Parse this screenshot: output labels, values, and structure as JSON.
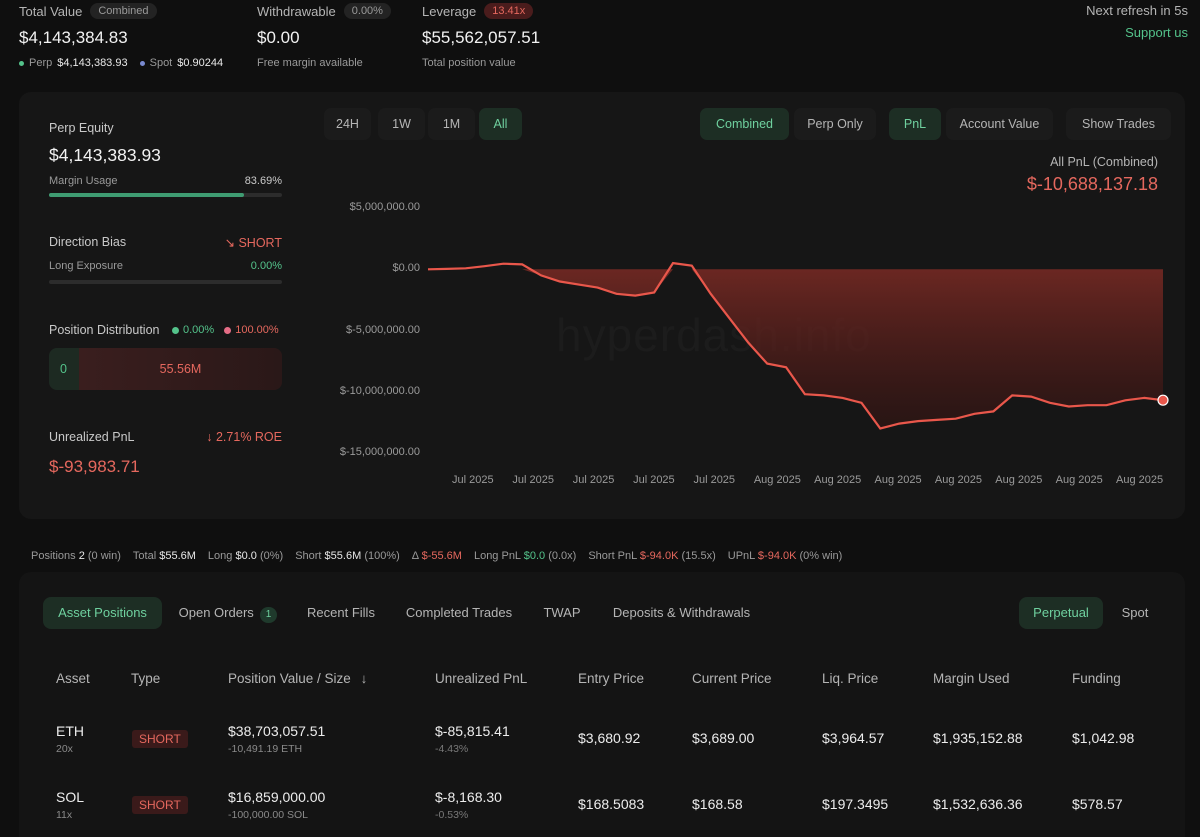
{
  "top": {
    "total_value": {
      "label": "Total Value",
      "pill": "Combined",
      "value": "$4,143,384.83",
      "perp_label": "Perp",
      "perp_value": "$4,143,383.93",
      "spot_label": "Spot",
      "spot_value": "$0.90244"
    },
    "withdrawable": {
      "label": "Withdrawable",
      "pill": "0.00%",
      "value": "$0.00",
      "sub": "Free margin available"
    },
    "leverage": {
      "label": "Leverage",
      "pill": "13.41x",
      "value": "$55,562,057.51",
      "sub": "Total position value"
    },
    "refresh": "Next refresh in 5s",
    "support": "Support us"
  },
  "left": {
    "perp_equity_label": "Perp Equity",
    "perp_equity_value": "$4,143,383.93",
    "margin_usage_label": "Margin Usage",
    "margin_usage_value": "83.69%",
    "margin_usage_fraction": 0.8369,
    "direction_bias_label": "Direction Bias",
    "direction_bias_value": "SHORT",
    "long_exposure_label": "Long Exposure",
    "long_exposure_value": "0.00%",
    "long_exposure_fraction": 0,
    "position_distribution_label": "Position Distribution",
    "dist_long_pct": "0.00%",
    "dist_short_pct": "100.00%",
    "dist_long_value": "0",
    "dist_short_value": "55.56M",
    "unrealized_label": "Unrealized PnL",
    "unrealized_roe": "2.71% ROE",
    "unrealized_value": "$-93,983.71"
  },
  "chart_controls": {
    "ranges": [
      "24H",
      "1W",
      "1M",
      "All"
    ],
    "active_range": "All",
    "combined": "Combined",
    "perp_only": "Perp Only",
    "pnl": "PnL",
    "account_value": "Account Value",
    "show_trades": "Show Trades",
    "summary_label": "All PnL (Combined)",
    "summary_value": "$-10,688,137.18"
  },
  "watermark": "hyperdash.info",
  "chart_data": {
    "type": "area",
    "title": "",
    "ylim": [
      -15000000,
      5000000
    ],
    "y_ticks": [
      "$5,000,000.00",
      "$0.00",
      "$-5,000,000.00",
      "$-10,000,000.00",
      "$-15,000,000.00"
    ],
    "x_ticks": [
      "Jul 2025",
      "Jul 2025",
      "Jul 2025",
      "Jul 2025",
      "Jul 2025",
      "Aug 2025",
      "Aug 2025",
      "Aug 2025",
      "Aug 2025",
      "Aug 2025",
      "Aug 2025",
      "Aug 2025"
    ],
    "series": [
      {
        "values": [
          0,
          30000,
          80000,
          250000,
          450000,
          400000,
          -500000,
          -1000000,
          -1250000,
          -1500000,
          -2000000,
          -2150000,
          -1900000,
          500000,
          300000,
          -2000000,
          -4000000,
          -6000000,
          -7700000,
          -8000000,
          -10200000,
          -10300000,
          -10500000,
          -10900000,
          -13000000,
          -12600000,
          -12400000,
          -12300000,
          -12200000,
          -11800000,
          -11600000,
          -10300000,
          -10400000,
          -10900000,
          -11200000,
          -11100000,
          -11100000,
          -10700000,
          -10500000,
          -10688137
        ]
      }
    ]
  },
  "summary_strip": {
    "positions_label": "Positions",
    "positions_value": "2",
    "positions_win": "(0 win)",
    "total_label": "Total",
    "total_value": "$55.6M",
    "long_label": "Long",
    "long_value": "$0.0",
    "long_pct": "(0%)",
    "short_label": "Short",
    "short_value": "$55.6M",
    "short_pct": "(100%)",
    "delta_label": "Δ",
    "delta_value": "$-55.6M",
    "long_pnl_label": "Long PnL",
    "long_pnl_value": "$0.0",
    "long_pnl_x": "(0.0x)",
    "short_pnl_label": "Short PnL",
    "short_pnl_value": "$-94.0K",
    "short_pnl_x": "(15.5x)",
    "upnl_label": "UPnL",
    "upnl_value": "$-94.0K",
    "upnl_win": "(0% win)"
  },
  "lower_tabs": {
    "asset_positions": "Asset Positions",
    "open_orders": "Open Orders",
    "open_orders_count": "1",
    "recent_fills": "Recent Fills",
    "completed_trades": "Completed Trades",
    "twap": "TWAP",
    "deposits": "Deposits & Withdrawals",
    "perpetual": "Perpetual",
    "spot": "Spot"
  },
  "table": {
    "headers": [
      "Asset",
      "Type",
      "Position Value / Size",
      "Unrealized PnL",
      "Entry Price",
      "Current Price",
      "Liq. Price",
      "Margin Used",
      "Funding"
    ],
    "rows": [
      {
        "asset": "ETH",
        "leverage": "20x",
        "type": "SHORT",
        "value": "$38,703,057.51",
        "size": "-10,491.19 ETH",
        "pnl": "$-85,815.41",
        "pnl_pct": "-4.43%",
        "entry": "$3,680.92",
        "current": "$3,689.00",
        "liq": "$3,964.57",
        "margin": "$1,935,152.88",
        "funding": "$1,042.98"
      },
      {
        "asset": "SOL",
        "leverage": "11x",
        "type": "SHORT",
        "value": "$16,859,000.00",
        "size": "-100,000.00 SOL",
        "pnl": "$-8,168.30",
        "pnl_pct": "-0.53%",
        "entry": "$168.5083",
        "current": "$168.58",
        "liq": "$197.3495",
        "margin": "$1,532,636.36",
        "funding": "$578.57"
      }
    ]
  },
  "colors": {
    "accent_green": "#54c38b",
    "negative_red": "#e5685e",
    "background": "#0f0f0f"
  }
}
